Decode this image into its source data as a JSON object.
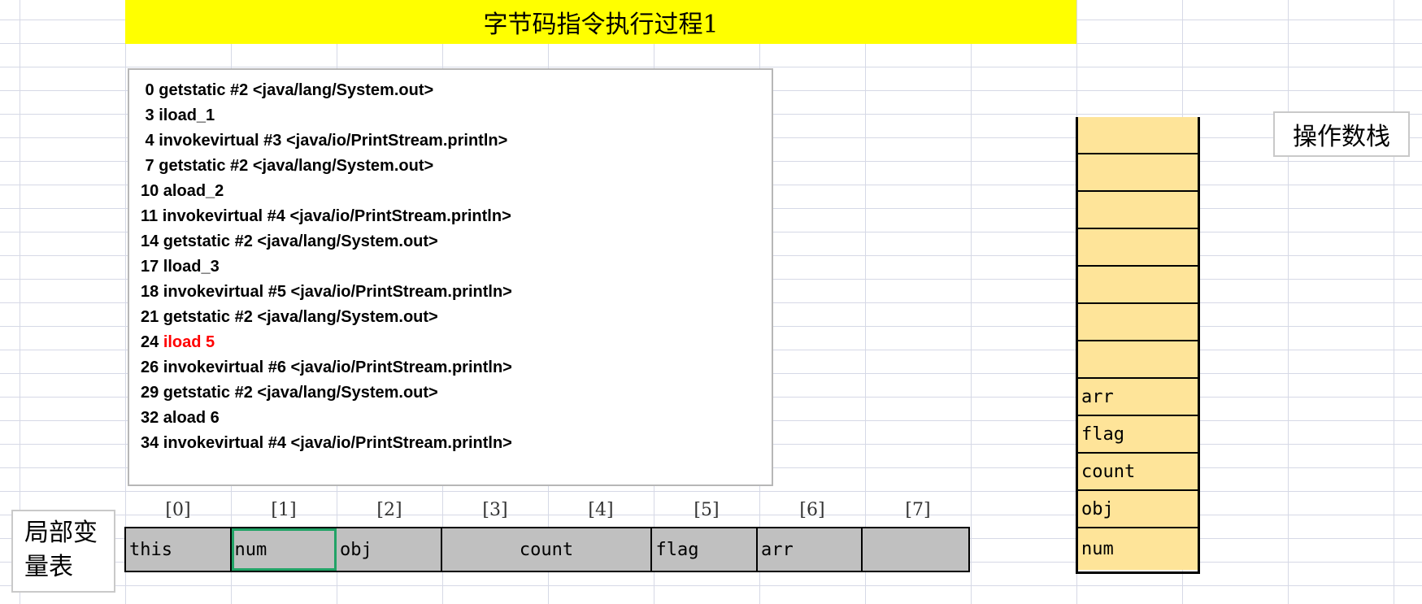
{
  "title": "字节码指令执行过程1",
  "bytecode": [
    {
      "text": " 0 getstatic #2 <java/lang/System.out>"
    },
    {
      "text": " 3 iload_1"
    },
    {
      "text": " 4 invokevirtual #3 <java/io/PrintStream.println>"
    },
    {
      "text": " 7 getstatic #2 <java/lang/System.out>"
    },
    {
      "text": "10 aload_2"
    },
    {
      "text": "11 invokevirtual #4 <java/io/PrintStream.println>"
    },
    {
      "text": "14 getstatic #2 <java/lang/System.out>"
    },
    {
      "text": "17 lload_3"
    },
    {
      "text": "18 invokevirtual #5 <java/io/PrintStream.println>"
    },
    {
      "text": "21 getstatic #2 <java/lang/System.out>"
    },
    {
      "prefix": "24 ",
      "highlight": "iload 5"
    },
    {
      "text": "26 invokevirtual #6 <java/io/PrintStream.println>"
    },
    {
      "text": "29 getstatic #2 <java/lang/System.out>"
    },
    {
      "text": "32 aload 6"
    },
    {
      "text": "34 invokevirtual #4 <java/io/PrintStream.println>"
    }
  ],
  "highlight_color": "#ff0000",
  "operand_stack": {
    "label": "操作数栈",
    "cells": [
      "",
      "",
      "",
      "",
      "",
      "",
      "",
      "arr",
      "flag",
      "count",
      "obj",
      "num"
    ],
    "fill_color": "#fee499"
  },
  "local_variable_table": {
    "label_line1": "局部变",
    "label_line2": "量表",
    "indices": [
      "[0]",
      "[1]",
      "[2]",
      "[3]",
      "[4]",
      "[5]",
      "[6]",
      "[7]"
    ],
    "cells": [
      {
        "value": "this",
        "span": 1
      },
      {
        "value": "num",
        "span": 1
      },
      {
        "value": "obj",
        "span": 1
      },
      {
        "value": "count",
        "span": 2
      },
      {
        "value": "flag",
        "span": 1
      },
      {
        "value": "arr",
        "span": 1
      },
      {
        "value": "",
        "span": 1
      }
    ],
    "selected_index": 1,
    "fill_color": "#c0c0c0"
  }
}
